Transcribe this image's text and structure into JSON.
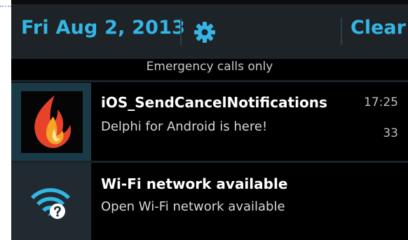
{
  "header": {
    "date": "Fri Aug 2, 2013",
    "settings_icon": "gear-icon",
    "clear_label": "Clear",
    "accent_color": "#33b5e5"
  },
  "status": {
    "emergency": "Emergency calls only"
  },
  "notifications": [
    {
      "icon": "delphi-flame-icon",
      "title": "iOS_SendCancelNotifications",
      "text": "Delphi for Android is here!",
      "time": "17:25",
      "count": "33"
    },
    {
      "icon": "wifi-question-icon",
      "title": "Wi-Fi network available",
      "text": "Open Wi-Fi network available"
    }
  ]
}
